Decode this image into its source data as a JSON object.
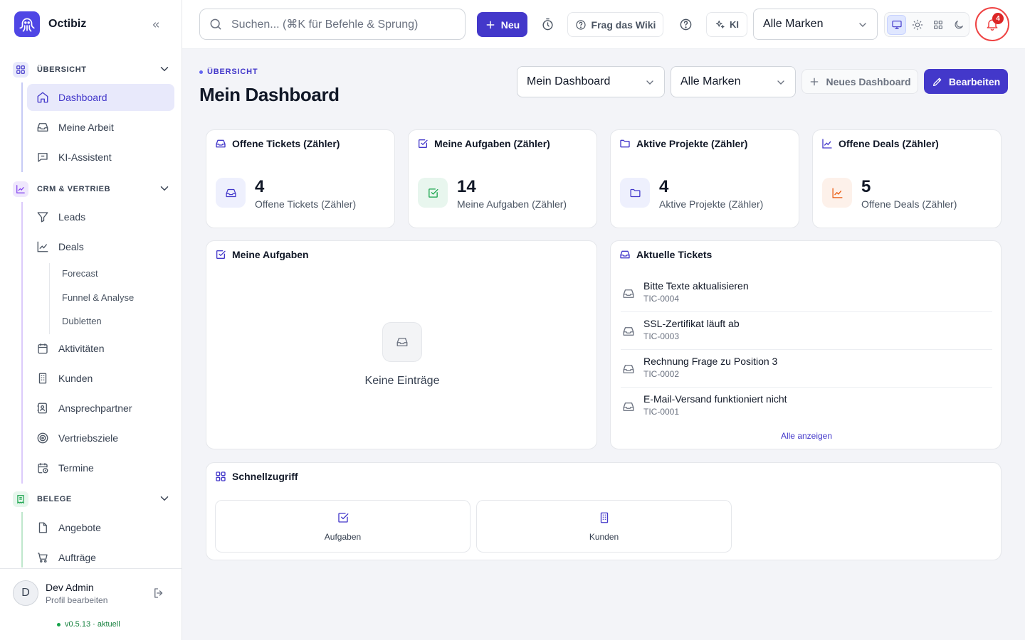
{
  "app": {
    "name": "Octibiz"
  },
  "sidebar": {
    "sections": [
      {
        "label": "ÜBERSICHT",
        "color": "#4338ca"
      },
      {
        "label": "CRM & VERTRIEB",
        "color": "#7c3aed"
      },
      {
        "label": "BELEGE",
        "color": "#15803d"
      }
    ],
    "items": {
      "dashboard": "Dashboard",
      "meine_arbeit": "Meine Arbeit",
      "ki_assistent": "KI-Assistent",
      "leads": "Leads",
      "deals": "Deals",
      "forecast": "Forecast",
      "funnel": "Funnel & Analyse",
      "dubletten": "Dubletten",
      "aktivitaeten": "Aktivitäten",
      "kunden": "Kunden",
      "ansprechpartner": "Ansprechpartner",
      "vertriebsziele": "Vertriebsziele",
      "termine": "Termine",
      "angebote": "Angebote",
      "auftraege": "Aufträge"
    },
    "user": {
      "initial": "D",
      "name": "Dev Admin",
      "sub": "Profil bearbeiten"
    },
    "version": "v0.5.13 · aktuell"
  },
  "topbar": {
    "search_placeholder": "Suchen... (⌘K für Befehle & Sprung)",
    "new_label": "Neu",
    "wiki_label": "Frag das Wiki",
    "ki_label": "KI",
    "brand_select": "Alle Marken",
    "notification_count": "4"
  },
  "header": {
    "eyebrow": "ÜBERSICHT",
    "title": "Mein Dashboard",
    "dashboard_select": "Mein Dashboard",
    "brand_select": "Alle Marken",
    "new_dashboard_label": "Neues Dashboard",
    "edit_label": "Bearbeiten"
  },
  "stats": [
    {
      "title": "Offene Tickets (Zähler)",
      "value": "4",
      "label": "Offene Tickets (Zähler)",
      "color": "#4338ca",
      "bg": "#eef0fd"
    },
    {
      "title": "Meine Aufgaben (Zähler)",
      "value": "14",
      "label": "Meine Aufgaben (Zähler)",
      "color": "#16a34a",
      "bg": "#e8f6ee"
    },
    {
      "title": "Aktive Projekte (Zähler)",
      "value": "4",
      "label": "Aktive Projekte (Zähler)",
      "color": "#4338ca",
      "bg": "#eef0fd"
    },
    {
      "title": "Offene Deals (Zähler)",
      "value": "5",
      "label": "Offene Deals (Zähler)",
      "color": "#ea580c",
      "bg": "#fdf1ea"
    }
  ],
  "tasks_widget": {
    "title": "Meine Aufgaben",
    "empty_text": "Keine Einträge"
  },
  "tickets_widget": {
    "title": "Aktuelle Tickets",
    "items": [
      {
        "title": "Bitte Texte aktualisieren",
        "id": "TIC-0004"
      },
      {
        "title": "SSL-Zertifikat läuft ab",
        "id": "TIC-0003"
      },
      {
        "title": "Rechnung Frage zu Position 3",
        "id": "TIC-0002"
      },
      {
        "title": "E-Mail-Versand funktioniert nicht",
        "id": "TIC-0001"
      }
    ],
    "show_all": "Alle anzeigen"
  },
  "quick_access": {
    "title": "Schnellzugriff",
    "items": [
      {
        "label": "Aufgaben"
      },
      {
        "label": "Kunden"
      }
    ]
  }
}
